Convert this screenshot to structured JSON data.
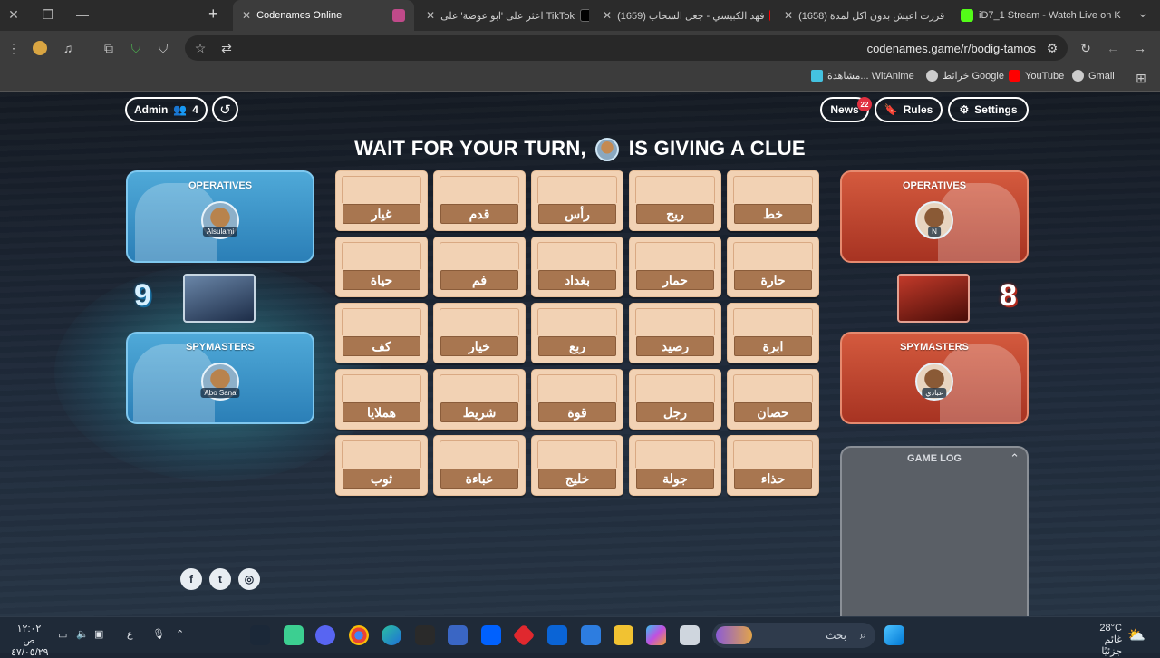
{
  "browser": {
    "tabs": [
      {
        "title": "iD7_1 Stream - Watch Live on K",
        "active": false
      },
      {
        "title": "(1658) قررت اعيش بدون اكل لمدة",
        "active": false
      },
      {
        "title": "(1659) فهد الكبيسي - جعل السحاب",
        "active": false
      },
      {
        "title": "اعثر على 'ابو عوضة' على TikTok",
        "active": false
      },
      {
        "title": "Codenames Online",
        "active": true
      }
    ],
    "url": "codenames.game/r/bodig-tamos",
    "bookmarks": [
      "Gmail",
      "YouTube",
      "خرائط Google",
      "مشاهدة... WitAnime"
    ]
  },
  "game": {
    "admin_label": "Admin",
    "player_count": "4",
    "news_label": "News",
    "news_badge": "22",
    "rules_label": "Rules",
    "settings_label": "Settings",
    "status_prefix": "WAIT FOR YOUR TURN,",
    "status_suffix": "IS GIVING A CLUE",
    "status_avatar_name": "Abo Sana",
    "blue_team": {
      "score": "9",
      "operatives_title": "OPERATIVES",
      "operative_name": "Alsulami",
      "spymasters_title": "SPYMASTERS",
      "spymaster_name": "Abo Sana"
    },
    "red_team": {
      "score": "8",
      "operatives_title": "OPERATIVES",
      "operative_name": "N",
      "spymasters_title": "SPYMASTERS",
      "spymaster_name": "عبادي"
    },
    "cards": [
      [
        "غيار",
        "قدم",
        "رأس",
        "ريح",
        "خط"
      ],
      [
        "حياة",
        "فم",
        "بغداد",
        "حمار",
        "حارة"
      ],
      [
        "كف",
        "خيار",
        "ربع",
        "رصيد",
        "ابرة"
      ],
      [
        "هملايا",
        "شريط",
        "قوة",
        "رجل",
        "حصان"
      ],
      [
        "ثوب",
        "عباءة",
        "خليج",
        "جولة",
        "حذاء"
      ]
    ],
    "game_log_title": "GAME LOG",
    "social": [
      "facebook-icon",
      "twitter-icon",
      "instagram-icon"
    ]
  },
  "taskbar": {
    "search_label": "بحث",
    "time": "١٢:٠٢ ص",
    "date": "٤٧/٠٥/٢٩",
    "lang": "ع",
    "weather_temp": "28°C",
    "weather_desc": "غائم جزئيًا"
  },
  "colors": {
    "blue_panel": "#3a94c8",
    "red_panel": "#c0452e",
    "card_bg": "#f2d2b4",
    "card_word_bg": "#a87650"
  }
}
